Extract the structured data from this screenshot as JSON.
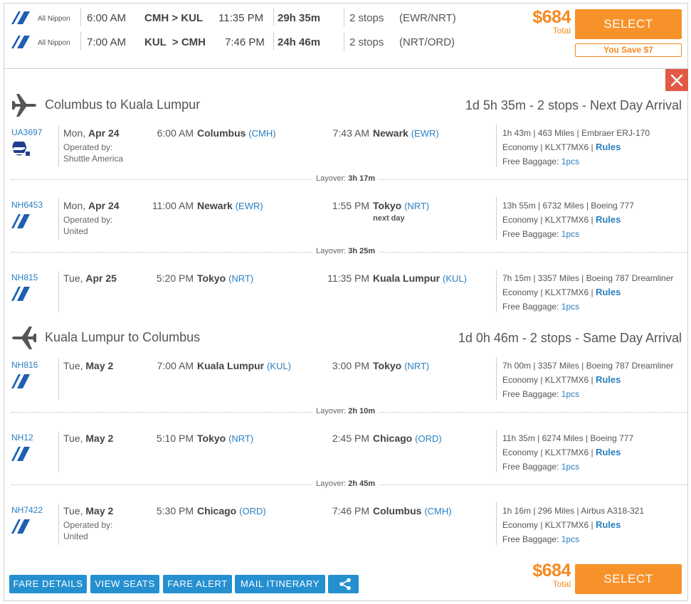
{
  "summary": {
    "rows": [
      {
        "airline": "All Nippon",
        "dep_time": "6:00 AM",
        "route": "CMH > KUL",
        "arr_time": "11:35 PM",
        "duration": "29h 35m",
        "stops": "2 stops",
        "via": "(EWR/NRT)"
      },
      {
        "airline": "All Nippon",
        "dep_time": "7:00 AM",
        "route": "KUL  > CMH",
        "arr_time": "7:46 PM",
        "duration": "24h 46m",
        "stops": "2 stops",
        "via": "(NRT/ORD)"
      }
    ],
    "price": "$684",
    "price_label": "Total",
    "select_label": "SELECT",
    "save_label": "You Save $7"
  },
  "directions": [
    {
      "title": "Columbus to Kuala Lumpur",
      "summary": "1d 5h 35m - 2 stops - Next Day Arrival",
      "segments": [
        {
          "flight": "UA3697",
          "day": "Mon,",
          "date": "Apr 24",
          "op_label": "Operated by:",
          "op_by": "Shuttle America",
          "dep_time": "6:00 AM",
          "dep_city": "Columbus",
          "dep_code": "(CMH)",
          "arr_time": "7:43 AM",
          "arr_city": "Newark",
          "arr_code": "(EWR)",
          "next_day": "",
          "info": "1h 43m | 463 Miles | Embraer ERJ-170",
          "cabin": "Economy | KLXT7MX6 |",
          "rules": "Rules",
          "bag_label": "Free Baggage:",
          "bag": "1pcs"
        },
        {
          "flight": "NH6453",
          "day": "Mon,",
          "date": "Apr 24",
          "op_label": "Operated by:",
          "op_by": "United",
          "dep_time": "11:00 AM",
          "dep_city": "Newark",
          "dep_code": "(EWR)",
          "arr_time": "1:55 PM",
          "arr_city": "Tokyo",
          "arr_code": "(NRT)",
          "next_day": "next day",
          "info": "13h 55m | 6732 Miles | Boeing 777",
          "cabin": "Economy | KLXT7MX6 |",
          "rules": "Rules",
          "bag_label": "Free Baggage:",
          "bag": "1pcs"
        },
        {
          "flight": "NH815",
          "day": "Tue,",
          "date": "Apr 25",
          "op_label": "",
          "op_by": "",
          "dep_time": "5:20 PM",
          "dep_city": "Tokyo",
          "dep_code": "(NRT)",
          "arr_time": "11:35 PM",
          "arr_city": "Kuala Lumpur",
          "arr_code": "(KUL)",
          "next_day": "",
          "info": "7h 15m | 3357 Miles | Boeing 787 Dreamliner",
          "cabin": "Economy | KLXT7MX6 |",
          "rules": "Rules",
          "bag_label": "Free Baggage:",
          "bag": "1pcs"
        }
      ],
      "layovers": [
        {
          "label": "Layover:",
          "time": "3h 17m"
        },
        {
          "label": "Layover:",
          "time": "3h 25m"
        }
      ]
    },
    {
      "title": "Kuala Lumpur to Columbus",
      "summary": "1d 0h 46m - 2 stops - Same Day Arrival",
      "segments": [
        {
          "flight": "NH816",
          "day": "Tue,",
          "date": "May 2",
          "op_label": "",
          "op_by": "",
          "dep_time": "7:00 AM",
          "dep_city": "Kuala Lumpur",
          "dep_code": "(KUL)",
          "arr_time": "3:00 PM",
          "arr_city": "Tokyo",
          "arr_code": "(NRT)",
          "next_day": "",
          "info": "7h 00m | 3357 Miles | Boeing 787 Dreamliner",
          "cabin": "Economy | KLXT7MX6 |",
          "rules": "Rules",
          "bag_label": "Free Baggage:",
          "bag": "1pcs"
        },
        {
          "flight": "NH12",
          "day": "Tue,",
          "date": "May 2",
          "op_label": "",
          "op_by": "",
          "dep_time": "5:10 PM",
          "dep_city": "Tokyo",
          "dep_code": "(NRT)",
          "arr_time": "2:45 PM",
          "arr_city": "Chicago",
          "arr_code": "(ORD)",
          "next_day": "",
          "info": "11h 35m | 6274 Miles | Boeing 777",
          "cabin": "Economy | KLXT7MX6 |",
          "rules": "Rules",
          "bag_label": "Free Baggage:",
          "bag": "1pcs"
        },
        {
          "flight": "NH7422",
          "day": "Tue,",
          "date": "May 2",
          "op_label": "Operated by:",
          "op_by": "United",
          "dep_time": "5:30 PM",
          "dep_city": "Chicago",
          "dep_code": "(ORD)",
          "arr_time": "7:46 PM",
          "arr_city": "Columbus",
          "arr_code": "(CMH)",
          "next_day": "",
          "info": "1h 16m | 296 Miles | Airbus A318-321",
          "cabin": "Economy | KLXT7MX6 |",
          "rules": "Rules",
          "bag_label": "Free Baggage:",
          "bag": "1pcs"
        }
      ],
      "layovers": [
        {
          "label": "Layover:",
          "time": "2h 10m"
        },
        {
          "label": "Layover:",
          "time": "2h 45m"
        }
      ]
    }
  ],
  "footer": {
    "fare_details": "FARE DETAILS",
    "view_seats": "VIEW SEATS",
    "fare_alert": "FARE ALERT",
    "mail_itinerary": "MAIL ITINERARY",
    "price": "$684",
    "price_label": "Total",
    "select_label": "SELECT"
  },
  "colors": {
    "accent_orange": "#f7922a",
    "link_blue": "#2a7fc1",
    "button_blue": "#2590d0",
    "close_red": "#e25a44",
    "ana_blue": "#1d5fb3",
    "united_blue": "#1f3e8f"
  },
  "icons": {
    "airline_logo": "ana-stripes-icon",
    "united_logo": "united-globe-icon",
    "outbound": "airplane-right-icon",
    "inbound": "airplane-left-icon",
    "close": "close-icon",
    "share": "share-icon"
  }
}
